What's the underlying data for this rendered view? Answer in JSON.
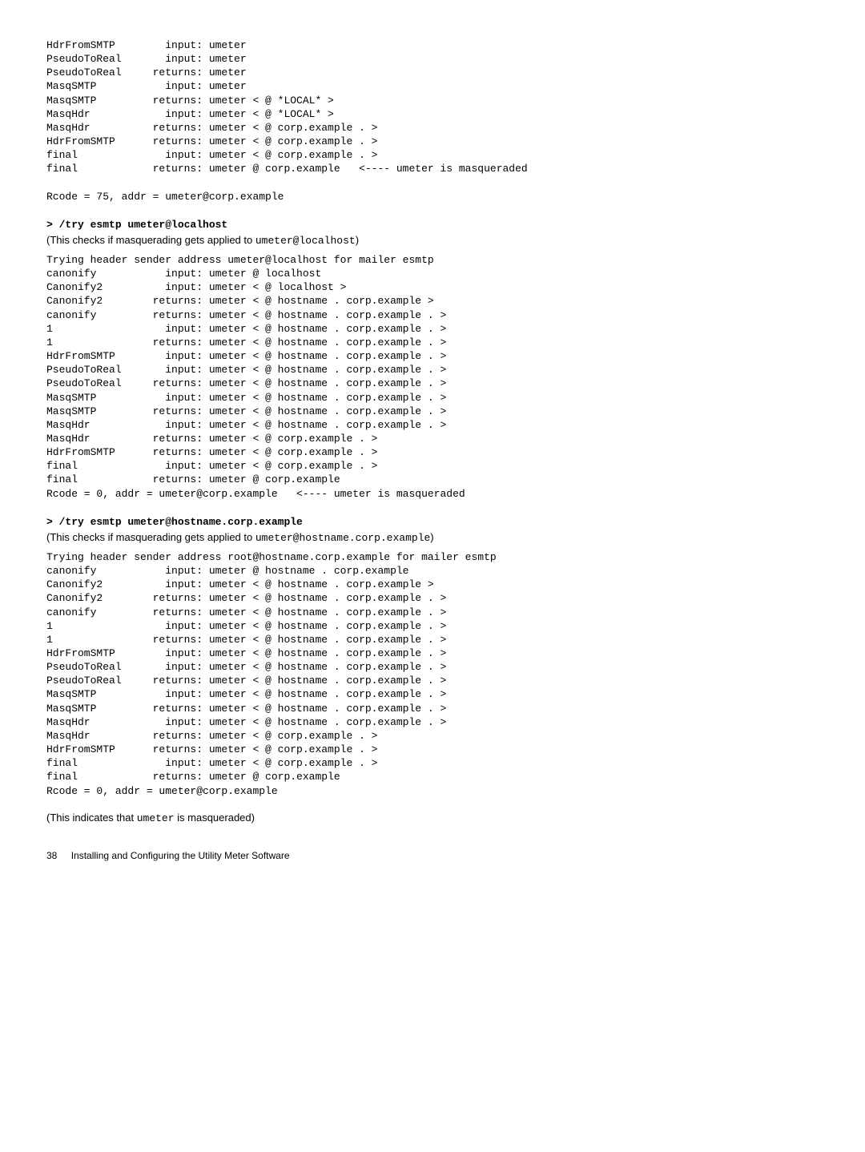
{
  "block1": "HdrFromSMTP        input: umeter\nPseudoToReal       input: umeter\nPseudoToReal     returns: umeter\nMasqSMTP           input: umeter\nMasqSMTP         returns: umeter < @ *LOCAL* >\nMasqHdr            input: umeter < @ *LOCAL* >\nMasqHdr          returns: umeter < @ corp.example . >\nHdrFromSMTP      returns: umeter < @ corp.example . >\nfinal              input: umeter < @ corp.example . >\nfinal            returns: umeter @ corp.example   <---- umeter is masqueraded\n\nRcode = 75, addr = umeter@corp.example",
  "sec2": {
    "heading": "> /try esmtp umeter@localhost",
    "narr_before": "(This checks if masquerading gets applied to ",
    "narr_code": "umeter@localhost",
    "narr_after": ")"
  },
  "block2": "Trying header sender address umeter@localhost for mailer esmtp\ncanonify           input: umeter @ localhost\nCanonify2          input: umeter < @ localhost >\nCanonify2        returns: umeter < @ hostname . corp.example >\ncanonify         returns: umeter < @ hostname . corp.example . >\n1                  input: umeter < @ hostname . corp.example . >\n1                returns: umeter < @ hostname . corp.example . >\nHdrFromSMTP        input: umeter < @ hostname . corp.example . >\nPseudoToReal       input: umeter < @ hostname . corp.example . >\nPseudoToReal     returns: umeter < @ hostname . corp.example . >\nMasqSMTP           input: umeter < @ hostname . corp.example . >\nMasqSMTP         returns: umeter < @ hostname . corp.example . >\nMasqHdr            input: umeter < @ hostname . corp.example . >\nMasqHdr          returns: umeter < @ corp.example . >\nHdrFromSMTP      returns: umeter < @ corp.example . >\nfinal              input: umeter < @ corp.example . >\nfinal            returns: umeter @ corp.example\nRcode = 0, addr = umeter@corp.example   <---- umeter is masqueraded",
  "sec3": {
    "heading": "> /try esmtp umeter@hostname.corp.example",
    "narr_before": "(This checks if masquerading gets applied to ",
    "narr_code": "umeter@hostname.corp.example",
    "narr_after": ")"
  },
  "block3": "Trying header sender address root@hostname.corp.example for mailer esmtp\ncanonify           input: umeter @ hostname . corp.example\nCanonify2          input: umeter < @ hostname . corp.example >\nCanonify2        returns: umeter < @ hostname . corp.example . >\ncanonify         returns: umeter < @ hostname . corp.example . >\n1                  input: umeter < @ hostname . corp.example . >\n1                returns: umeter < @ hostname . corp.example . >\nHdrFromSMTP        input: umeter < @ hostname . corp.example . >\nPseudoToReal       input: umeter < @ hostname . corp.example . >\nPseudoToReal     returns: umeter < @ hostname . corp.example . >\nMasqSMTP           input: umeter < @ hostname . corp.example . >\nMasqSMTP         returns: umeter < @ hostname . corp.example . >\nMasqHdr            input: umeter < @ hostname . corp.example . >\nMasqHdr          returns: umeter < @ corp.example . >\nHdrFromSMTP      returns: umeter < @ corp.example . >\nfinal              input: umeter < @ corp.example . >\nfinal            returns: umeter @ corp.example\nRcode = 0, addr = umeter@corp.example",
  "closing": {
    "before": "(This indicates that ",
    "code": "umeter",
    "after": " is masqueraded)"
  },
  "footer": {
    "page": "38",
    "title": "Installing and Configuring the Utility Meter Software"
  }
}
